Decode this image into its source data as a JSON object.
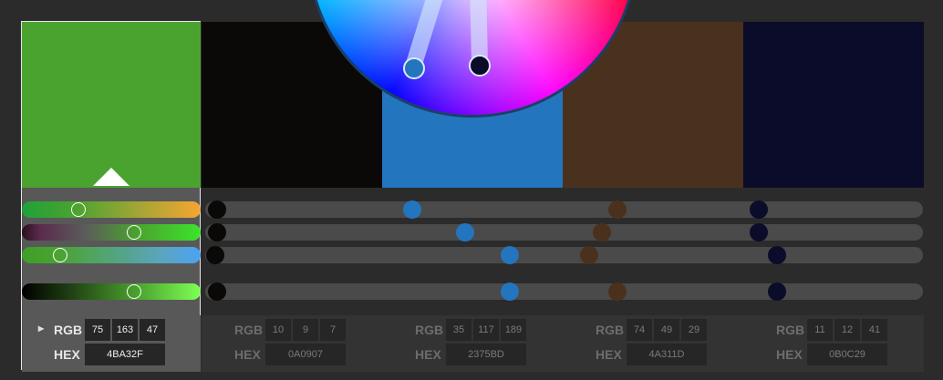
{
  "swatches": [
    {
      "name": "swatch-1",
      "hex": "4BA32F",
      "color": "#4ba32f",
      "rgb": [
        "75",
        "163",
        "47"
      ],
      "selected": true
    },
    {
      "name": "swatch-2",
      "hex": "0A0907",
      "color": "#0a0907",
      "rgb": [
        "10",
        "9",
        "7"
      ]
    },
    {
      "name": "swatch-3",
      "hex": "2375BD",
      "color": "#2375bd",
      "rgb": [
        "35",
        "117",
        "189"
      ]
    },
    {
      "name": "swatch-4",
      "hex": "4A311D",
      "color": "#4a311d",
      "rgb": [
        "74",
        "49",
        "29"
      ]
    },
    {
      "name": "swatch-5",
      "hex": "0B0C29",
      "color": "#0b0c29",
      "rgb": [
        "11",
        "12",
        "41"
      ]
    }
  ],
  "labels": {
    "rgb": "RGB",
    "hex": "HEX",
    "expand": "▸"
  },
  "sliders": [
    {
      "name": "hue",
      "value": 0.32
    },
    {
      "name": "saturation",
      "value": 0.64
    },
    {
      "name": "blue",
      "value": 0.21
    },
    {
      "name": "brightness",
      "value": 0.64
    }
  ]
}
